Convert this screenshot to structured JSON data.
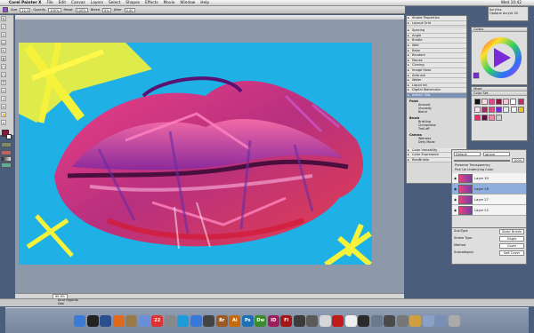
{
  "menubar": {
    "apple": "",
    "app": "Corel Painter X",
    "items": [
      "File",
      "Edit",
      "Canvas",
      "Layers",
      "Select",
      "Shapes",
      "Effects",
      "Movie",
      "Window",
      "Help"
    ],
    "clock": "Wed 10:42"
  },
  "propbar": {
    "size_label": "Size",
    "size": "22.3",
    "opacity_label": "Opacity",
    "opacity": "100%",
    "resat_label": "Resat",
    "resat": "100%",
    "bleed_label": "Bleed",
    "bleed": "0%",
    "jitter_label": "Jitter",
    "jitter": "0.00"
  },
  "navigator": {
    "line1": "Acrylics",
    "line2": "Opaque Acrylic 20"
  },
  "brush_controls": {
    "items": [
      "Stroke Properties",
      "Layout Grid",
      "Spacing",
      "Angle",
      "Bristle",
      "Well",
      "Rake",
      "Random",
      "Mouse",
      "Cloning",
      "Image Hose",
      "Airbrush",
      "Water",
      "Liquid Ink",
      "Digital Watercolor",
      "Artists' Oils",
      "Impasto",
      "Color Variability",
      "Color Expression",
      "RealBristle"
    ],
    "selected": "Artists' Oils",
    "sub": {
      "paint_label": "Paint",
      "amount": "Amount",
      "viscosity": "Viscosity",
      "blend": "Blend",
      "brush_label": "Brush",
      "bristling": "Bristling",
      "clumpiness": "Clumpiness",
      "trail_off": "Trail-off",
      "canvas_label": "Canvas",
      "wetness": "Wetness",
      "dirty_mode": "Dirty Mode"
    }
  },
  "colors_panel": {
    "title": "Colors",
    "accent": "#7a2ad6"
  },
  "mixer_panel": {
    "title": "Mixer"
  },
  "swatches_panel": {
    "title": "Color Set"
  },
  "layers_panel": {
    "composite_method": "Default",
    "composite_depth": "Ignore",
    "opacity": "100%",
    "preserve_transparency": "Preserve Transparency",
    "pick_up_underlying": "Pick Up Underlying Color",
    "layers": [
      "Layer 30",
      "Layer 28",
      "Layer 27",
      "Layer 22"
    ],
    "selected": "Layer 28"
  },
  "stroke_info": {
    "rows": [
      {
        "label": "Sub-Type",
        "value": "Static Bristle"
      },
      {
        "label": "Stroke Type",
        "value": "Single"
      },
      {
        "label": "Method",
        "value": "Cover"
      },
      {
        "label": "Subcategory",
        "value": "Soft Cover"
      }
    ]
  },
  "document": {
    "zoom": "66.6%",
    "status": "Kind regards,"
  },
  "status_lines": [
    "Kind regards",
    "Dan"
  ],
  "dock_icons": [
    {
      "name": "finder",
      "label": "",
      "color": "#3a7bd5"
    },
    {
      "name": "dashboard",
      "label": "",
      "color": "#222"
    },
    {
      "name": "spaces",
      "label": "",
      "color": "#2a4f8e"
    },
    {
      "name": "firefox",
      "label": "",
      "color": "#e0691c"
    },
    {
      "name": "preview",
      "label": "",
      "color": "#9a7a4a"
    },
    {
      "name": "itunes",
      "label": "",
      "color": "#6b8ed8"
    },
    {
      "name": "ical",
      "label": "22",
      "color": "#d33"
    },
    {
      "name": "mail",
      "label": "",
      "color": "#888"
    },
    {
      "name": "skype",
      "label": "",
      "color": "#1d9bd8"
    },
    {
      "name": "ichat",
      "label": "",
      "color": "#3a78d8"
    },
    {
      "name": "facetime",
      "label": "",
      "color": "#444"
    },
    {
      "name": "bridge",
      "label": "Br",
      "color": "#9b5a22"
    },
    {
      "name": "illustrator",
      "label": "Ai",
      "color": "#c46a0d"
    },
    {
      "name": "photoshop",
      "label": "Ps",
      "color": "#1e6fb5"
    },
    {
      "name": "dreamweaver",
      "label": "Dw",
      "color": "#3c8a2b"
    },
    {
      "name": "indesign",
      "label": "ID",
      "color": "#9c1e5a"
    },
    {
      "name": "flash",
      "label": "Fl",
      "color": "#a31616"
    },
    {
      "name": "painter",
      "label": "",
      "color": "#3b3b3b"
    },
    {
      "name": "app1",
      "label": "",
      "color": "#5a5a5a"
    },
    {
      "name": "app2",
      "label": "",
      "color": "#d6d6d6"
    },
    {
      "name": "acrobat",
      "label": "",
      "color": "#c21a1a"
    },
    {
      "name": "app3",
      "label": "",
      "color": "#eee"
    },
    {
      "name": "app4",
      "label": "",
      "color": "#2a2a2a"
    },
    {
      "name": "app5",
      "label": "",
      "color": "#6a7a8a"
    },
    {
      "name": "app6",
      "label": "",
      "color": "#4a4a4a"
    },
    {
      "name": "app7",
      "label": "",
      "color": "#777"
    },
    {
      "name": "app8",
      "label": "",
      "color": "#d0a040"
    },
    {
      "name": "docs",
      "label": "",
      "color": "#8aa0c8"
    },
    {
      "name": "downloads",
      "label": "",
      "color": "#7a8fb5"
    },
    {
      "name": "trash",
      "label": "",
      "color": "#aaa"
    }
  ]
}
